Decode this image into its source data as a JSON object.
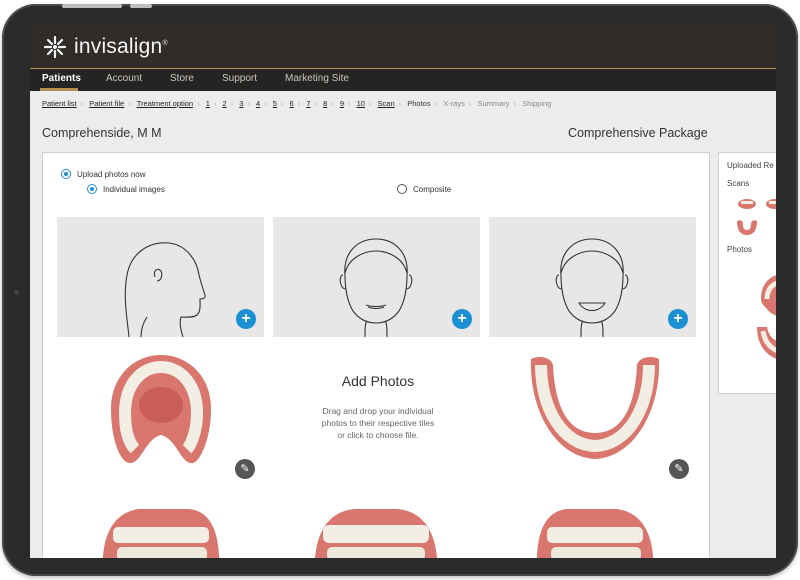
{
  "brand": {
    "name": "invisalign",
    "mark": "®"
  },
  "nav": {
    "items": [
      "Patients",
      "Account",
      "Store",
      "Support",
      "Marketing Site"
    ],
    "active": "Patients"
  },
  "breadcrumb": {
    "links": [
      "Patient list",
      "Patient file",
      "Treatment option",
      "1",
      "2",
      "3",
      "4",
      "5",
      "6",
      "7",
      "8",
      "9",
      "10",
      "Scan"
    ],
    "current": "Photos",
    "upcoming": [
      "X-rays",
      "Summary",
      "Shipping"
    ]
  },
  "patient": {
    "name": "Comprehenside, M M",
    "package": "Comprehensive Package"
  },
  "upload": {
    "option_now": "Upload photos now",
    "option_individual": "Individual images",
    "option_composite": "Composite"
  },
  "dropzone": {
    "title": "Add Photos",
    "line1": "Drag and drop your individual",
    "line2": "photos to their respective tiles",
    "line3": "or click to choose file."
  },
  "sidebar": {
    "title": "Uploaded Re",
    "scans_label": "Scans",
    "photos_label": "Photos"
  },
  "icons": {
    "add": "plus-icon",
    "edit": "pencil-icon",
    "logo": "starburst-icon"
  },
  "colors": {
    "accent": "#1a8fd4",
    "gold": "#b49152",
    "topbar": "#2f2c29"
  }
}
